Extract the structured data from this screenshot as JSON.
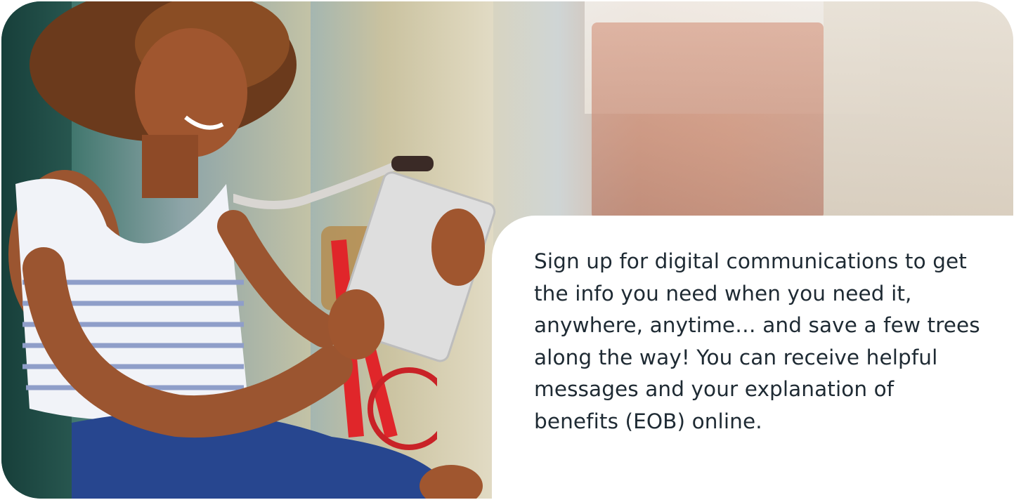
{
  "banner": {
    "message": "Sign up for digital communications to get the info you need when you need it, anywhere, anytime… and save a few trees along the way!  You can receive helpful messages and your explanation of benefits (EOB) online.",
    "photo_alt": "Woman with curly hair smiling at a tablet, sitting by a red bicycle on a city street"
  }
}
